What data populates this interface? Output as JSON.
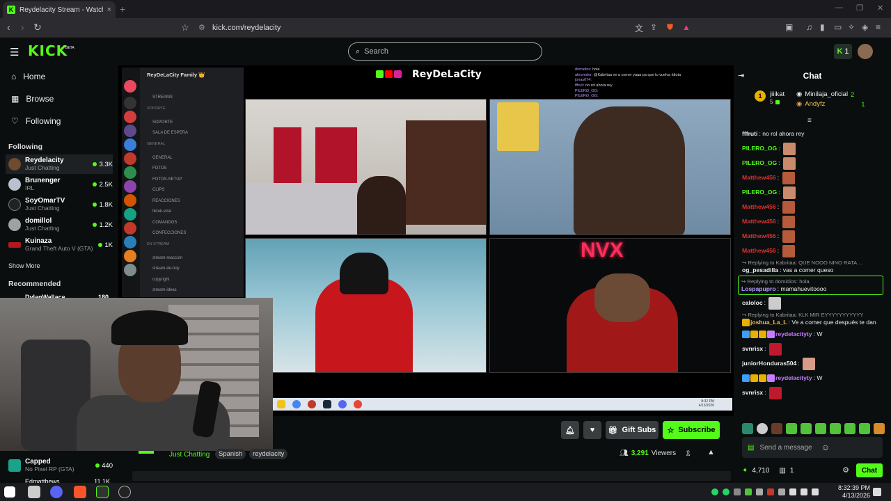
{
  "browser": {
    "tab_title": "Reydelacity Stream - Watch Live",
    "tab_close": "×",
    "new_tab": "+",
    "url": "kick.com/reydelacity",
    "back": "‹",
    "forward": "›",
    "reload": "↻",
    "bookmark": "🔖",
    "site_info": "⚙"
  },
  "header": {
    "logo": "KICK",
    "beta": "BETA",
    "search_placeholder": "Search",
    "notif_count": "1"
  },
  "sidebar": {
    "nav": [
      {
        "label": "Home",
        "icon": "⌂"
      },
      {
        "label": "Browse",
        "icon": "▦"
      },
      {
        "label": "Following",
        "icon": "♡"
      }
    ],
    "following_title": "Following",
    "following": [
      {
        "name": "Reydelacity",
        "category": "Just Chatting",
        "viewers": "3.3K",
        "color": "#6e4a2e"
      },
      {
        "name": "Brunenger",
        "category": "IRL",
        "viewers": "2.5K",
        "color": "#b8c2cf"
      },
      {
        "name": "SoyOmarTV",
        "category": "Just Chatting",
        "viewers": "1.8K",
        "color": "#222"
      },
      {
        "name": "domillol",
        "category": "Just Chatting",
        "viewers": "1.2K",
        "color": "#a1a1a1"
      },
      {
        "name": "Kuinaza",
        "category": "Grand Theft Auto V (GTA)",
        "viewers": "1K",
        "color": "#b01a1a"
      }
    ],
    "show_more": "Show More",
    "recommended_title": "Recommended",
    "recommended_partial": {
      "name": "DylanWallace",
      "viewers": "180"
    },
    "lower": [
      {
        "name": "Capped",
        "category": "No Pixel RP (GTA)",
        "viewers": "440"
      },
      {
        "name": "Edmatthews",
        "viewers": "11.1K"
      }
    ]
  },
  "stream": {
    "overlay_title": "ReyDeLaCity",
    "discord_server": "ReyDeLaCity Family 👑",
    "discord_channels": [
      {
        "label": "STREAMS",
        "cat": false
      },
      {
        "label": "SOPORTE",
        "cat": true
      },
      {
        "label": "SOPORTE",
        "cat": false
      },
      {
        "label": "SALA DE ESPERA",
        "cat": false
      },
      {
        "label": "GENERAL",
        "cat": true
      },
      {
        "label": "GENERAL",
        "cat": false
      },
      {
        "label": "FOTOS",
        "cat": false
      },
      {
        "label": "FOTOS-SETUP",
        "cat": false
      },
      {
        "label": "CLIPS",
        "cat": false
      },
      {
        "label": "REACCIONES",
        "cat": false
      },
      {
        "label": "tiktok-viral",
        "cat": false
      },
      {
        "label": "COMANDOS",
        "cat": false
      },
      {
        "label": "CONFECCIONES",
        "cat": false
      },
      {
        "label": "EN STREAM",
        "cat": true
      },
      {
        "label": "stream-reaccion",
        "cat": false
      },
      {
        "label": "stream-de-hoy",
        "cat": false
      },
      {
        "label": "copyright",
        "cat": false
      },
      {
        "label": "stream-ideas",
        "cat": false
      }
    ],
    "chat_overlay": [
      {
        "user": "domidios",
        "text": "hola"
      },
      {
        "user": "alexvndor",
        "text": "@Kabritaa ve a comer yaaa pa que tu vuelva Idiota"
      },
      {
        "user": "jonas674",
        "text": ""
      },
      {
        "user": "fffruti",
        "text": "no rol ahora rey"
      },
      {
        "user": "PILERO_OG",
        "text": ""
      },
      {
        "user": "PILERO_OG",
        "text": ""
      },
      {
        "user": "Matthew456",
        "text": ""
      },
      {
        "user": "PILERO_OG",
        "text": ""
      },
      {
        "user": "Matthew456",
        "text": ""
      },
      {
        "user": "Matthew456",
        "text": ""
      },
      {
        "user": "Matthew456",
        "text": ""
      },
      {
        "user": "Matthew456",
        "text": ""
      },
      {
        "user": "og_pesadilla",
        "text": "vas a comer queso"
      },
      {
        "user": "Lospapupro",
        "text": "mamahuevitoooo"
      }
    ],
    "inner_clock_time": "8:32 PM",
    "inner_clock_date": "4/13/2026"
  },
  "controls": {
    "bell": "🔔",
    "heart": "♥",
    "gift_subs": "Gift Subs",
    "subscribe": "Subscribe",
    "category": "Just Chatting",
    "tags": [
      "Spanish",
      "reydelacity"
    ],
    "viewers": "3,291",
    "viewers_label": "Viewers"
  },
  "chat": {
    "title": "Chat",
    "gifters": [
      {
        "name": "jiiikat",
        "count": "5",
        "rank": "1"
      },
      {
        "name": "Minilaja_oficial",
        "count": "2"
      },
      {
        "name": "Andyfz",
        "count": "1"
      }
    ],
    "messages": [
      {
        "user": "fffruti",
        "color": "#eeeeee",
        "text": "no rol ahora rey",
        "emote": ""
      },
      {
        "user": "PILERO_OG",
        "color": "#53fc18",
        "text": "",
        "emote": "#c98b6b"
      },
      {
        "user": "PILERO_OG",
        "color": "#53fc18",
        "text": "",
        "emote": "#c98b6b"
      },
      {
        "user": "Matthew456",
        "color": "#e03030",
        "text": "",
        "emote": "#b55a3a"
      },
      {
        "user": "PILERO_OG",
        "color": "#53fc18",
        "text": "",
        "emote": "#c98b6b"
      },
      {
        "user": "Matthew456",
        "color": "#e03030",
        "text": "",
        "emote": "#b55a3a"
      },
      {
        "user": "Matthew456",
        "color": "#e03030",
        "text": "",
        "emote": "#b55a3a"
      },
      {
        "user": "Matthew456",
        "color": "#e03030",
        "text": "",
        "emote": "#b55a3a"
      },
      {
        "user": "Matthew456",
        "color": "#e03030",
        "text": "",
        "emote": "#b55a3a"
      }
    ],
    "reply1": {
      "reply_to": "Replying to Kabritaa: QUE NOOO NINO RATA ...",
      "user": "og_pesadilla",
      "text": "vas a comer queso"
    },
    "reply2": {
      "reply_to": "Replying to domidios: hola",
      "user": "Lospapupro",
      "text": "mamahuevitoooo"
    },
    "msg_caloloc": {
      "user": "caloloc"
    },
    "reply3": {
      "reply_to": "Replying to Kabritaa: KLK MIR EYYYYYYYYYYY",
      "user": "joshua_La_L",
      "text": "Ve a comer que después te dan"
    },
    "msg_w1": {
      "user": "reydelacityty",
      "text": "W"
    },
    "msg_svnrisx1": {
      "user": "svnrisx"
    },
    "msg_honduras": {
      "user": "juniorHonduras504"
    },
    "msg_w2": {
      "user": "reydelacityty",
      "text": "W"
    },
    "msg_svnrisx2": {
      "user": "svnrisx"
    },
    "input_placeholder": "Send a message",
    "points": "4,710",
    "gift_count": "1",
    "chat_button": "Chat"
  },
  "taskbar": {
    "time": "8:32:39 PM",
    "date": "4/13/2026"
  }
}
